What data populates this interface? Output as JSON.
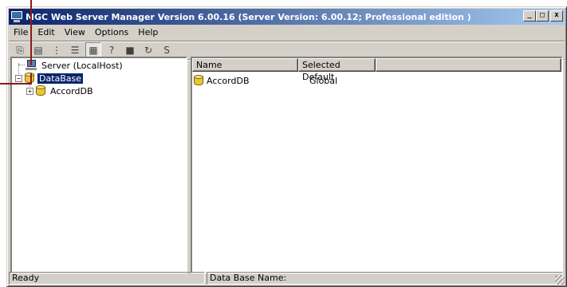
{
  "window": {
    "title": "MGC Web Server Manager Version 6.00.16  (Server Version: 6.00.12;  Professional edition )",
    "minimize_glyph": "_",
    "maximize_glyph": "□",
    "close_glyph": "x"
  },
  "menu": [
    {
      "label": "File"
    },
    {
      "label": "Edit"
    },
    {
      "label": "View"
    },
    {
      "label": "Options"
    },
    {
      "label": "Help"
    }
  ],
  "toolbar": [
    {
      "name": "copy-icon",
      "glyph": "⎘"
    },
    {
      "name": "paste-icon",
      "glyph": "▤"
    },
    {
      "name": "tree-view-icon",
      "glyph": "⋮"
    },
    {
      "name": "details-view-icon",
      "glyph": "☰"
    },
    {
      "name": "grid-view-icon",
      "glyph": "▦"
    },
    {
      "name": "help-icon",
      "glyph": "?"
    },
    {
      "name": "database-icon",
      "glyph": "■"
    },
    {
      "name": "refresh-icon",
      "glyph": "↻"
    },
    {
      "name": "reconnect-icon",
      "glyph": "S"
    }
  ],
  "tree": {
    "server_label": "Server (LocalHost)",
    "database_label": "DataBase",
    "child_label": "AccordDB",
    "expander_minus": "−",
    "expander_plus": "+"
  },
  "list": {
    "columns": [
      "Name",
      "Selected Default"
    ],
    "rows": [
      {
        "name": "AccordDB",
        "default": "Global"
      }
    ]
  },
  "status": {
    "left": "Ready",
    "middle": "Data Base Name:"
  },
  "colors": {
    "title_gradient_start": "#0a246a",
    "title_gradient_end": "#a6caf0",
    "selection": "#0a246a",
    "callout": "#8b1a1a"
  }
}
